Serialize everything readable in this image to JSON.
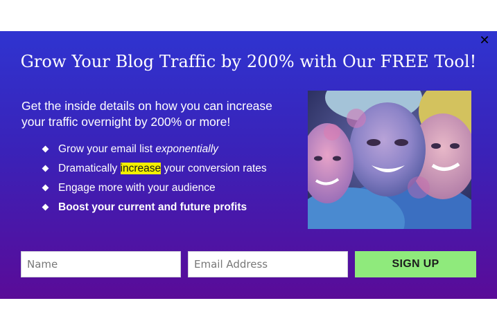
{
  "popup": {
    "title": "Grow Your Blog Traffic by 200% with Our FREE Tool!",
    "close_icon": "close-icon",
    "intro": "Get the inside details on how you can increase your traffic overnight by 200% or more!",
    "bullets": [
      {
        "before": "Grow your email list ",
        "emphasis": "exponentially",
        "after": ""
      },
      {
        "before": "Dramatically ",
        "highlight": "increase",
        "after": " your conversion rates"
      },
      {
        "text": "Engage more with your audience"
      },
      {
        "text": "Boost your current and future profits"
      }
    ],
    "bullet_icon": "diamond-bullet-icon",
    "photo": "festival-colors-photo"
  },
  "form": {
    "name_placeholder": "Name",
    "email_placeholder": "Email Address",
    "submit_label": "SIGN UP"
  },
  "colors": {
    "gradient_top": "#2f34d0",
    "gradient_bottom": "#5a0b98",
    "button": "#8fea7c",
    "highlight": "#f3f000"
  }
}
